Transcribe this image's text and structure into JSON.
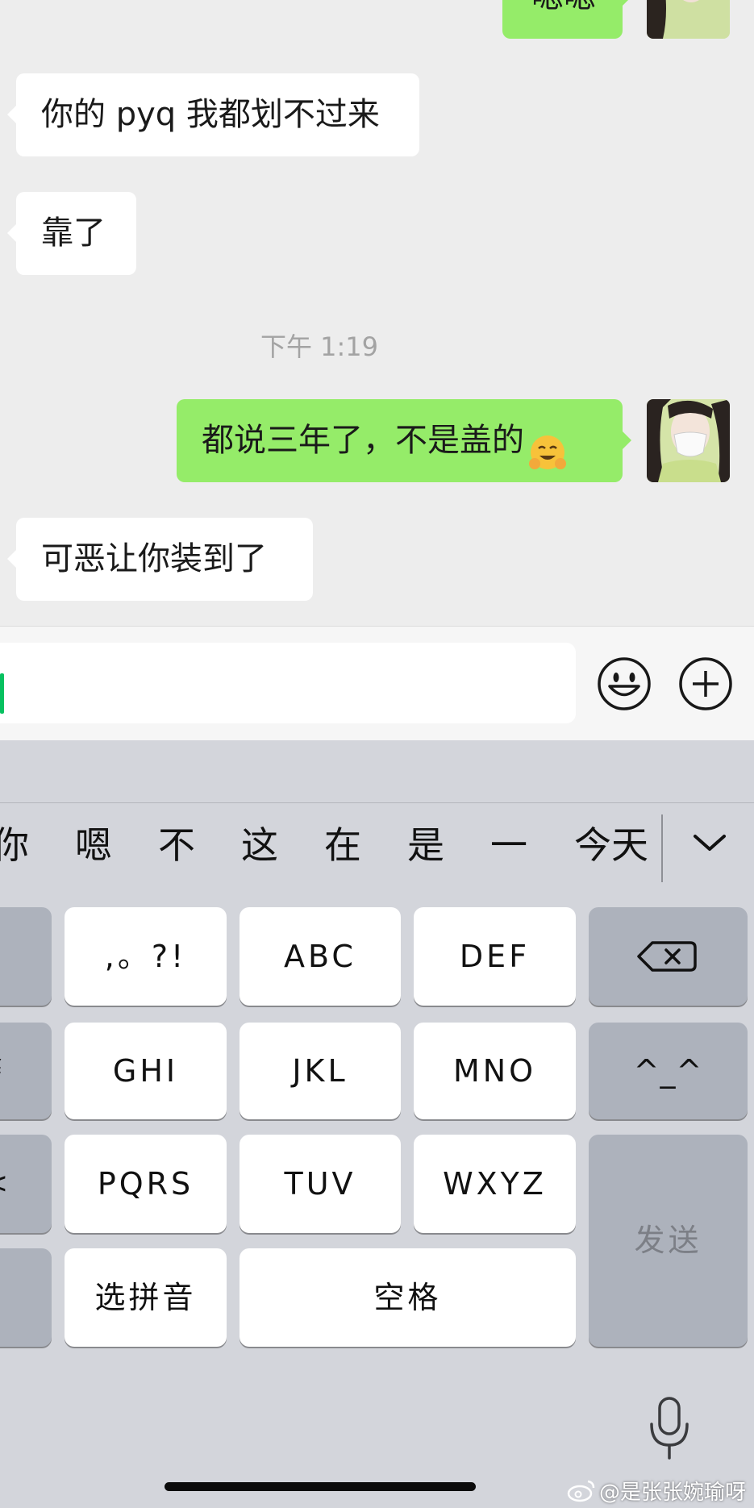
{
  "chat": {
    "partial_top_bubble": "嗯嗯",
    "messages": [
      {
        "text": "你的 pyq 我都划不过来"
      },
      {
        "text": "靠了"
      },
      {
        "text": "都说三年了，不是盖的"
      },
      {
        "text": "可恶让你装到了"
      }
    ],
    "timestamp": "下午 1:19"
  },
  "keyboard": {
    "candidates": [
      "你",
      "嗯",
      "不",
      "这",
      "在",
      "是",
      "一",
      "今天"
    ],
    "keys": {
      "punct": ",。?!",
      "abc": "ABC",
      "def": "DEF",
      "ghi": "GHI",
      "jkl": "JKL",
      "mno": "MNO",
      "kaomoji": "^_^",
      "pqrs": "PQRS",
      "tuv": "TUV",
      "wxyz": "WXYZ",
      "send": "发送",
      "select_pinyin": "选拼音",
      "space": "空格"
    },
    "left_edge_glyphs": [
      "¥",
      "<"
    ]
  },
  "watermark": "@是张张婉瑜呀",
  "colors": {
    "outgoing_bubble": "#95ec69",
    "cursor": "#07c160",
    "background": "#ededed"
  },
  "icons": [
    "emoji-face-icon",
    "add-circle-icon",
    "chevron-down-icon",
    "backspace-icon",
    "microphone-icon",
    "weibo-logo-icon"
  ]
}
